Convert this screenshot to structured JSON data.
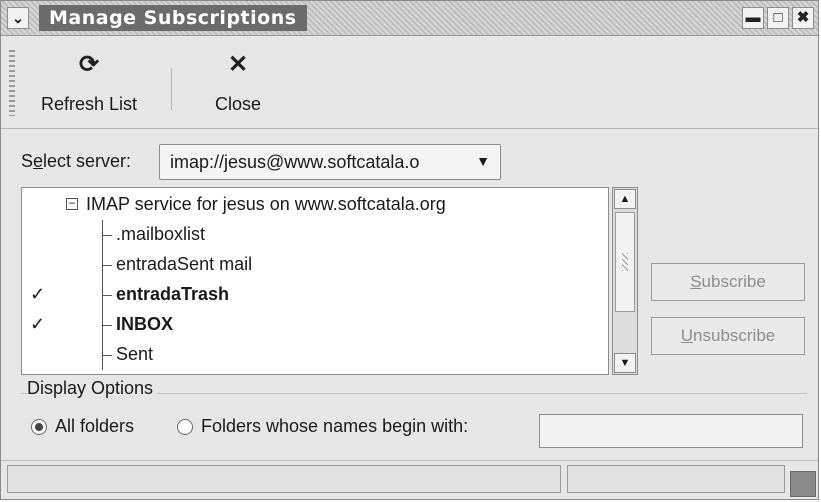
{
  "window": {
    "title": "Manage Subscriptions",
    "menu_icon": "chevron-down-icon",
    "controls": [
      {
        "name": "minimize-icon",
        "glyph": "▬"
      },
      {
        "name": "maximize-icon",
        "glyph": "□"
      },
      {
        "name": "close-icon",
        "glyph": "✖"
      }
    ]
  },
  "toolbar": {
    "refresh_label": "Refresh List",
    "refresh_icon": "refresh-icon",
    "close_label": "Close",
    "close_icon": "close-x-icon"
  },
  "server": {
    "label_pre": "S",
    "label_underlined": "e",
    "label_post": "lect server:",
    "value": "imap://jesus@www.softcatala.o"
  },
  "tree": {
    "root_label": "IMAP service for jesus on www.softcatala.org",
    "items": [
      {
        "label": ".mailboxlist",
        "subscribed": false,
        "bold": false
      },
      {
        "label": "entradaSent mail",
        "subscribed": false,
        "bold": false
      },
      {
        "label": "entradaTrash",
        "subscribed": true,
        "bold": true
      },
      {
        "label": "INBOX",
        "subscribed": true,
        "bold": true
      },
      {
        "label": "Sent",
        "subscribed": false,
        "bold": false
      }
    ],
    "check_glyph": "✓"
  },
  "buttons": {
    "subscribe_underlined": "S",
    "subscribe_rest": "ubscribe",
    "unsubscribe_underlined": "U",
    "unsubscribe_rest": "nsubscribe"
  },
  "display_options": {
    "title": "Display Options",
    "all_folders": "All folders",
    "prefix_option": "Folders whose names begin with:",
    "selected": "all_folders",
    "prefix_value": ""
  },
  "colors": {
    "window_bg": "#e6e6e6",
    "title_bg": "#6b6b6b",
    "disabled_text": "#8d8d8d"
  }
}
